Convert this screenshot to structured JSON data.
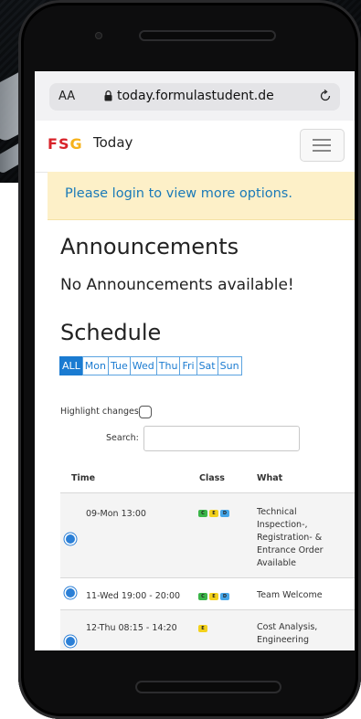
{
  "browser": {
    "text_size_label": "AA",
    "url": "today.formulastudent.de"
  },
  "navbar": {
    "logo_f": "F",
    "logo_s": "S",
    "logo_g": "G",
    "brand_suffix": "Today"
  },
  "alert": {
    "text": "Please login to view more options."
  },
  "announcements": {
    "heading": "Announcements",
    "empty_text": "No Announcements available!"
  },
  "schedule": {
    "heading": "Schedule",
    "days": [
      "ALL",
      "Mon",
      "Tue",
      "Wed",
      "Thu",
      "Fri",
      "Sat",
      "Sun"
    ],
    "active_day": "ALL",
    "highlight_label": "Highlight changes:",
    "search_label": "Search:",
    "search_value": "",
    "columns": [
      "Time",
      "Class",
      "What"
    ],
    "rows": [
      {
        "time": "09-Mon 13:00",
        "classes": [
          "C",
          "E",
          "D"
        ],
        "what": [
          "Technical",
          "Inspection-,",
          "Registration- &",
          "Entrance Order",
          "Available"
        ]
      },
      {
        "time": "11-Wed 19:00 - 20:00",
        "classes": [
          "C",
          "E",
          "D"
        ],
        "what": [
          "Team Welcome"
        ]
      },
      {
        "time": "12-Thu 08:15 - 14:20",
        "classes": [
          "E"
        ],
        "what": [
          "Cost Analysis,",
          "Engineering"
        ]
      }
    ]
  },
  "colors": {
    "accent_blue": "#1a7bd1",
    "alert_bg": "#fdf0c8",
    "class_c": "#3bb549",
    "class_e": "#f3d11c",
    "class_d": "#46a6e8"
  }
}
